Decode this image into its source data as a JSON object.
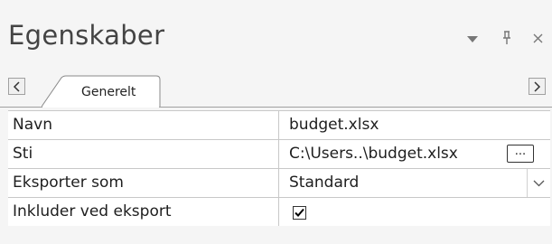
{
  "panel": {
    "title": "Egenskaber",
    "controls": {
      "dropdown_icon": "▼",
      "pin_icon": "📌",
      "close_icon": "×"
    }
  },
  "tabs": {
    "active": "Generelt"
  },
  "properties": [
    {
      "name": "Navn",
      "value": "budget.xlsx"
    },
    {
      "name": "Sti",
      "value": "C:\\Users..\\budget.xlsx",
      "browse_label": "..."
    },
    {
      "name": "Eksporter som",
      "value": "Standard"
    },
    {
      "name": "Inkluder ved eksport",
      "checked": true
    }
  ],
  "colors": {
    "background": "#f5f5f5",
    "grid_line": "#c8c8c8",
    "title_text": "#444444"
  }
}
